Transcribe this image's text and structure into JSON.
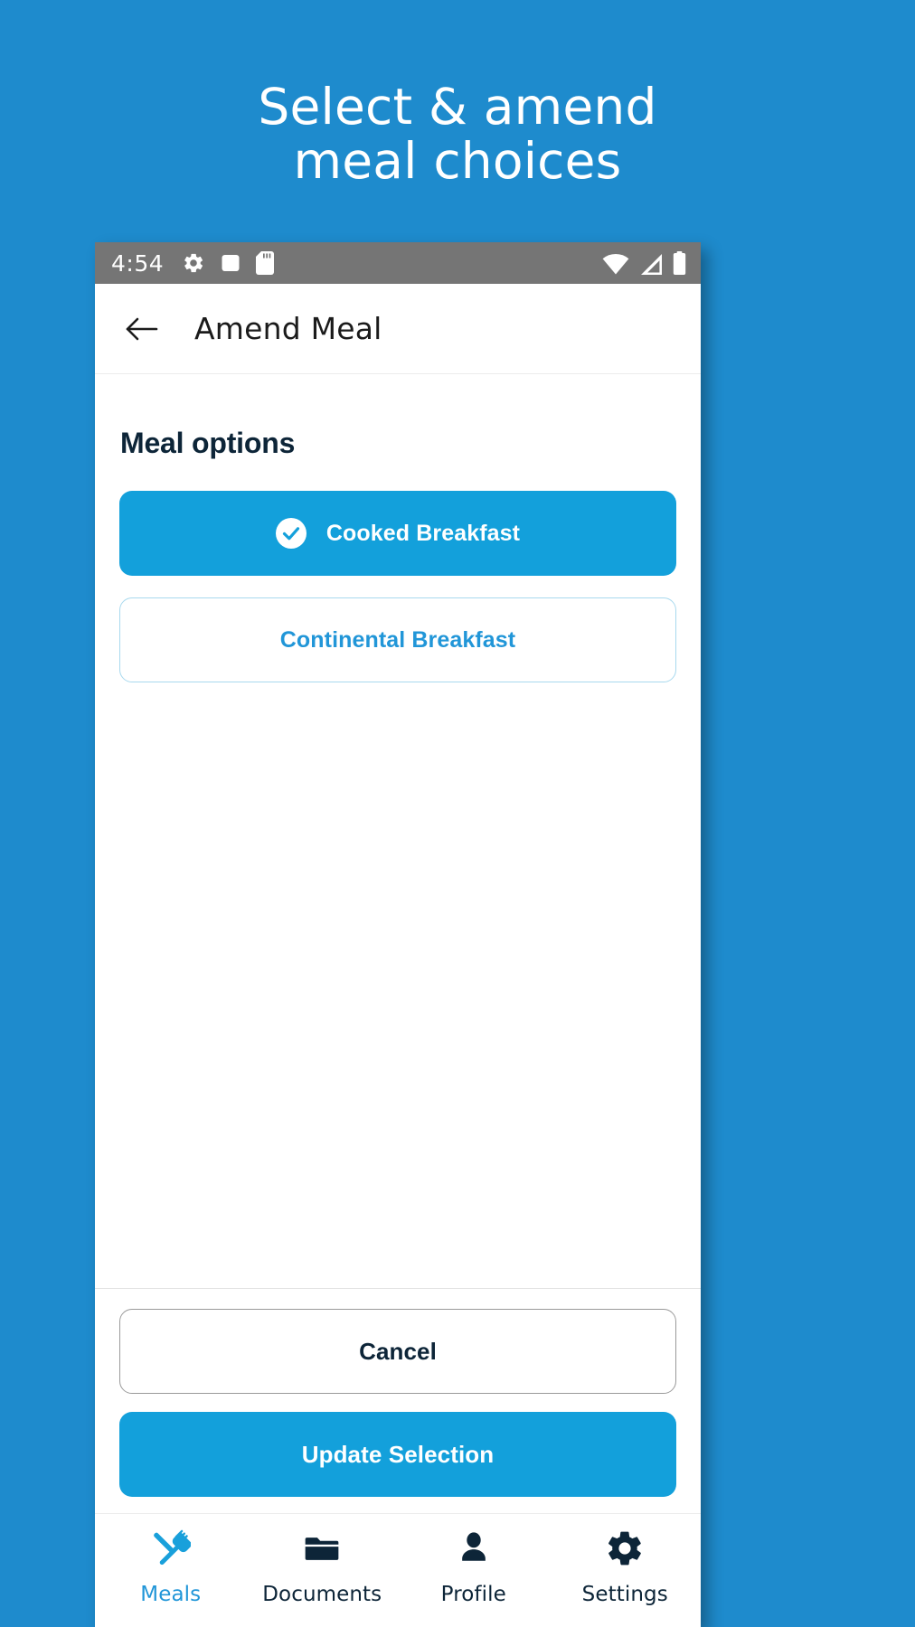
{
  "promo": {
    "line1": "Select & amend",
    "line2": "meal choices"
  },
  "colors": {
    "background": "#1e8bcd",
    "accent": "#13a0db",
    "accent_text": "#2196d8",
    "dark_navy": "#0d2538",
    "statusbar": "#757575"
  },
  "statusbar": {
    "time": "4:54",
    "left_icons": [
      "gear-icon",
      "rounded-square-icon",
      "sd-card-icon"
    ],
    "right_icons": [
      "wifi-icon",
      "signal-icon",
      "battery-icon"
    ]
  },
  "appbar": {
    "back_icon": "back-arrow-icon",
    "title": "Amend Meal"
  },
  "main": {
    "section_title": "Meal options",
    "options": [
      {
        "label": "Cooked Breakfast",
        "selected": true,
        "icon": "check-circle-icon"
      },
      {
        "label": "Continental Breakfast",
        "selected": false,
        "icon": ""
      }
    ]
  },
  "actions": {
    "cancel_label": "Cancel",
    "update_label": "Update Selection"
  },
  "bottom_nav": {
    "items": [
      {
        "label": "Meals",
        "icon": "cutlery-icon",
        "active": true
      },
      {
        "label": "Documents",
        "icon": "folder-icon",
        "active": false
      },
      {
        "label": "Profile",
        "icon": "person-icon",
        "active": false
      },
      {
        "label": "Settings",
        "icon": "gear-icon",
        "active": false
      }
    ]
  }
}
